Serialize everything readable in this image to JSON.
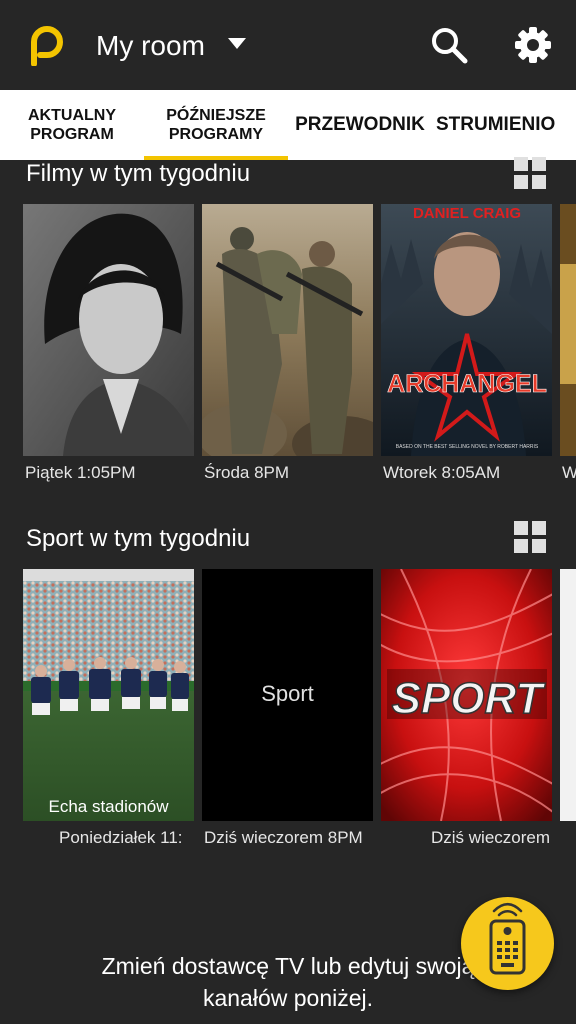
{
  "header": {
    "logo_icon": "plex-p-logo",
    "title": "My room",
    "search_icon": "search-icon",
    "settings_icon": "gear-icon",
    "accent": "#f3c400"
  },
  "tabs": [
    {
      "line1": "AKTUALNY",
      "line2": "PROGRAM"
    },
    {
      "line1": "PÓŹNIEJSZE",
      "line2": "PROGRAMY"
    },
    {
      "label": "PRZEWODNIK"
    },
    {
      "label": "STRUMIENIO"
    }
  ],
  "movies": {
    "title": "Filmy w tym tygodniu",
    "items": [
      {
        "caption": "Piątek 1:05PM"
      },
      {
        "caption": "Środa 8PM"
      },
      {
        "caption": "Wtorek 8:05AM",
        "poster_actor": "DANIEL CRAIG",
        "poster_title": "ARCHANGEL",
        "poster_footer": "BASED ON THE BEST SELLING NOVEL BY ROBERT HARRIS"
      },
      {
        "caption": "W"
      }
    ]
  },
  "sports": {
    "title": "Sport w tym tygodniu",
    "items": [
      {
        "overlay": "Echa stadionów",
        "caption": "Poniedziałek 11:"
      },
      {
        "overlay": "Sport",
        "caption": "Dziś wieczorem 8PM"
      },
      {
        "overlay": "SPORT",
        "caption": "Dziś wieczorem"
      }
    ]
  },
  "footer": {
    "line1": "Zmień dostawcę TV lub edytuj swoją",
    "line2": "kanałów poniżej.",
    "fab_icon": "remote-control-icon"
  }
}
